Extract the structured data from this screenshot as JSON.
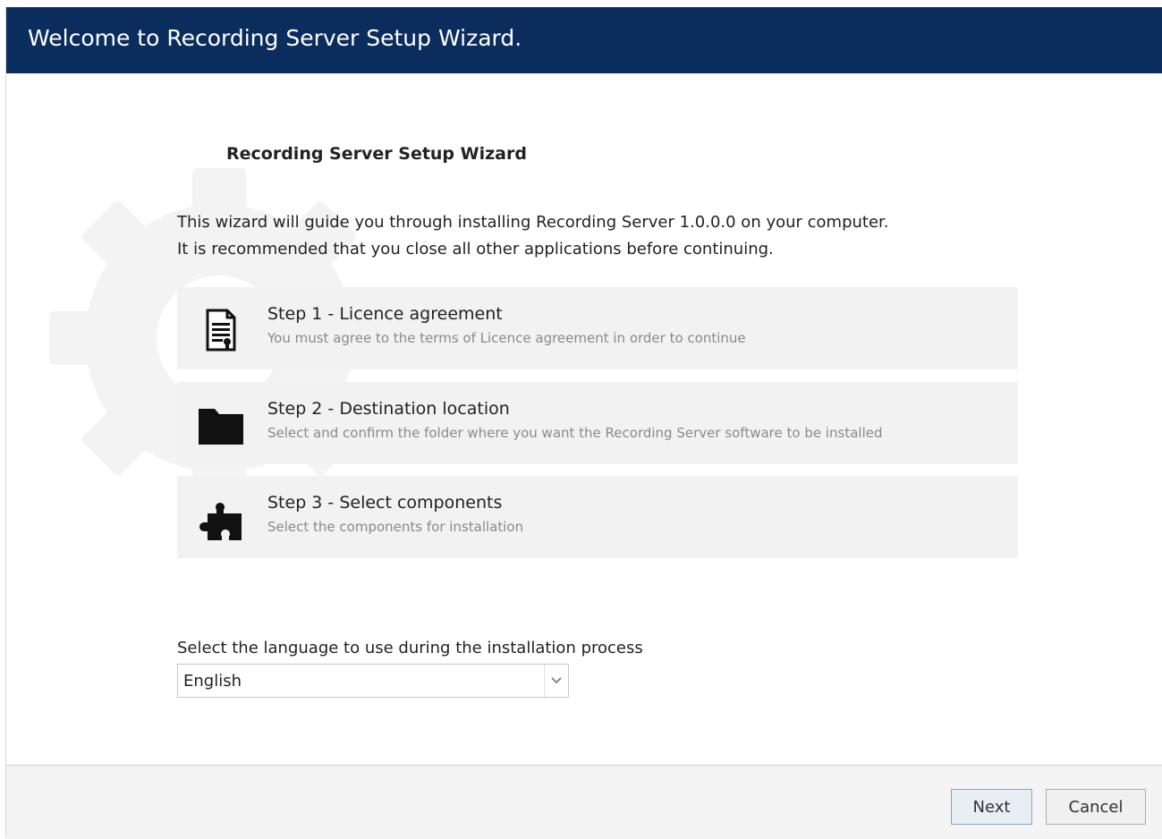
{
  "window": {
    "title": "Welcome to Recording Server Setup Wizard."
  },
  "main": {
    "heading": "Recording Server Setup Wizard",
    "intro_line1": "This wizard will guide you through installing Recording Server 1.0.0.0 on your computer.",
    "intro_line2": "It is recommended that you close all other applications before continuing.",
    "steps": [
      {
        "icon": "document-icon",
        "title": "Step 1 - Licence agreement",
        "description": "You must agree to the terms of Licence agreement in order to continue"
      },
      {
        "icon": "folder-icon",
        "title": "Step 2 - Destination location",
        "description": "Select and confirm the folder where you want the Recording Server software to be installed"
      },
      {
        "icon": "puzzle-icon",
        "title": "Step 3 - Select components",
        "description": "Select the components for installation"
      }
    ],
    "language": {
      "label": "Select the language to use during the installation process",
      "selected": "English"
    }
  },
  "footer": {
    "next_label": "Next",
    "cancel_label": "Cancel"
  },
  "colors": {
    "titlebar": "#0b2d5e",
    "step_background": "#f2f2f2",
    "footer_background": "#f4f4f4"
  }
}
